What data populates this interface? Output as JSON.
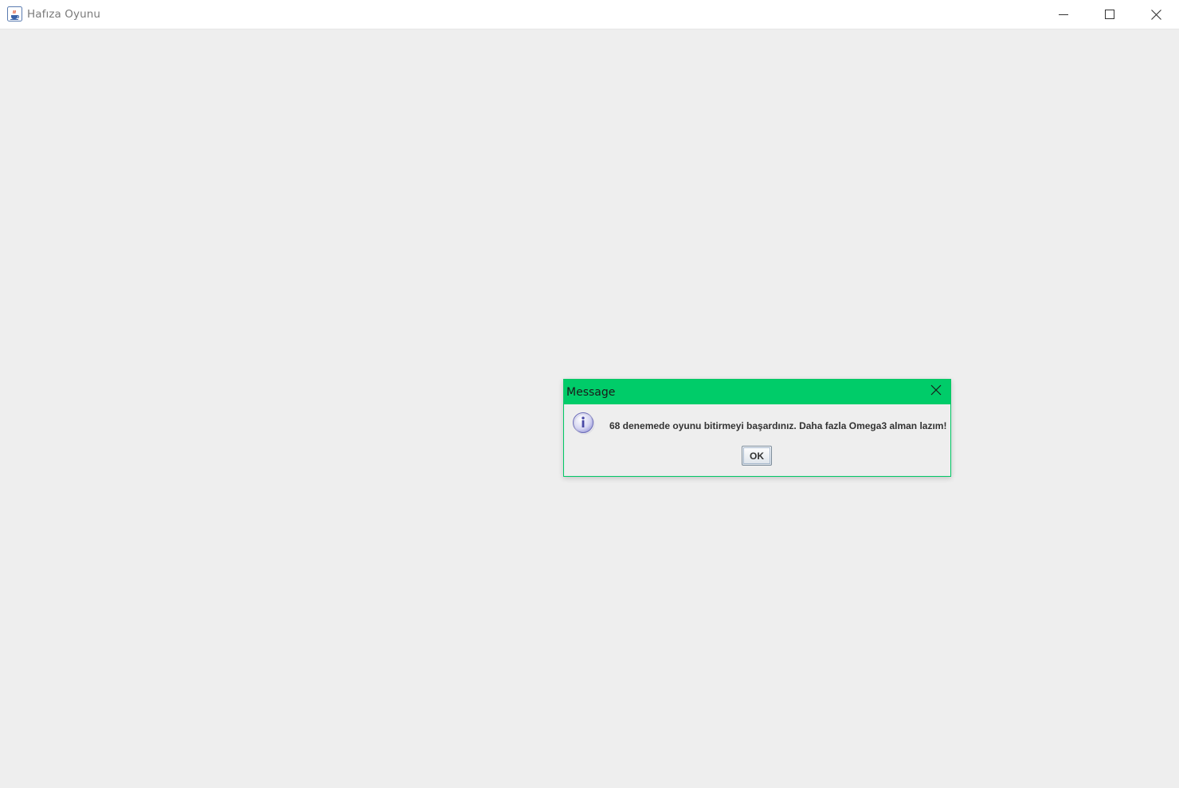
{
  "window": {
    "title": "Hafıza Oyunu",
    "icon": "java-cup-icon",
    "controls": {
      "minimize_icon": "minimize-icon",
      "maximize_icon": "maximize-icon",
      "close_icon": "close-icon"
    }
  },
  "dialog": {
    "title": "Message",
    "close_icon": "close-icon",
    "message_icon": "info-icon",
    "message": "68 denemede oyunu bitirmeyi başardınız. Daha fazla Omega3 alman lazım!",
    "ok_label": "OK",
    "accent_color": "#00cc69"
  }
}
